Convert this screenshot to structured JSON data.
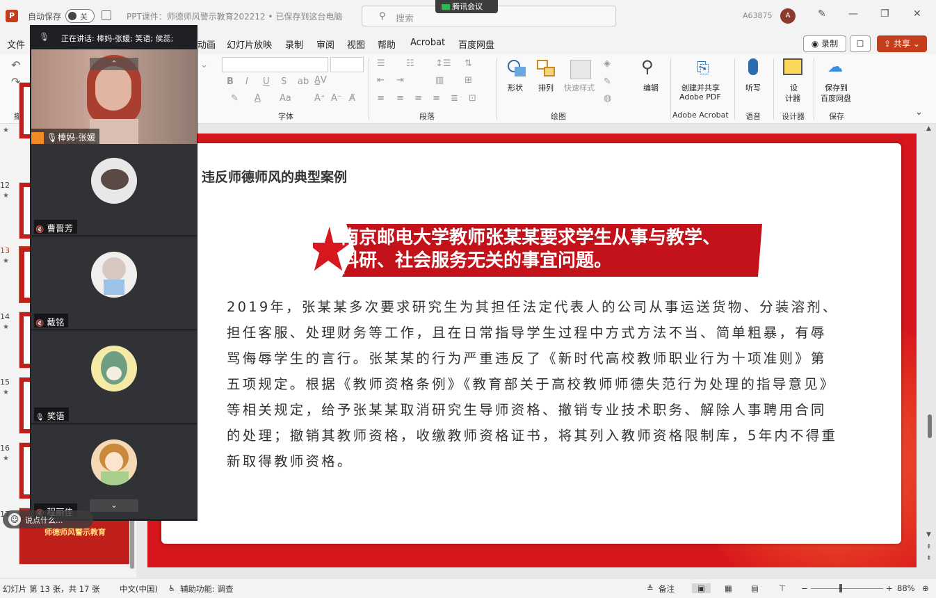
{
  "window": {
    "autosave_label": "自动保存",
    "autosave_state": "关",
    "title": "PPT课件：师德师风警示教育202212 • 已保存到这台电脑",
    "search_placeholder": "搜索",
    "meeting_app": "腾讯会议",
    "user_id": "A63875",
    "avatar_initial": "A"
  },
  "menu": {
    "items": [
      "文件",
      "动画",
      "幻灯片放映",
      "录制",
      "审阅",
      "视图",
      "帮助",
      "Acrobat",
      "百度网盘"
    ],
    "record_button": "录制",
    "share_button": "共享"
  },
  "ribbon": {
    "undo_group": "撤消",
    "font_group": "字体",
    "paragraph_group": "段落",
    "drawing_group": "绘图",
    "shapes": "形状",
    "arrange": "排列",
    "quick_styles": "快速样式",
    "editing": "编辑",
    "create_share_pdf": "创建并共享",
    "adobe_pdf": "Adobe PDF",
    "adobe_group": "Adobe Acrobat",
    "dictate": "听写",
    "voice_group": "语音",
    "designer_1": "设",
    "designer_2": "计器",
    "designer_group": "设计器",
    "save_baidu_1": "保存到",
    "save_baidu_2": "百度网盘",
    "save_group": "保存"
  },
  "thumbnails": [
    {
      "num": "",
      "star": "★"
    },
    {
      "num": "12",
      "star": "★"
    },
    {
      "num": "13",
      "star": "★",
      "active": true
    },
    {
      "num": "14",
      "star": "★"
    },
    {
      "num": "15",
      "star": "★"
    },
    {
      "num": "16",
      "star": "★"
    },
    {
      "num": "17",
      "star": "",
      "caption": "师德师风警示教育"
    }
  ],
  "slide": {
    "heading": "违反师德师风的典型案例",
    "banner": "南京邮电大学教师张某某要求学生从事与教学、科研、社会服务无关的事宜问题。",
    "body": "2019年，张某某多次要求研究生为其担任法定代表人的公司从事运送货物、分装溶剂、担任客服、处理财务等工作，且在日常指导学生过程中方式方法不当、简单粗暴，有辱骂侮辱学生的言行。张某某的行为严重违反了《新时代高校教师职业行为十项准则》第五项规定。根据《教师资格条例》《教育部关于高校教师师德失范行为处理的指导意见》等相关规定，给予张某某取消研究生导师资格、撤销专业技术职务、解除人事聘用合同的处理；撤销其教师资格，收缴教师资格证书，将其列入教师资格限制库，5年内不得重新取得教师资格。"
  },
  "status": {
    "slide_info": "幻灯片 第 13 张，共 17 张",
    "language": "中文(中国)",
    "accessibility": "辅助功能: 调查",
    "notes": "备注",
    "zoom": "88%"
  },
  "meeting": {
    "speaking": "正在讲话: 棒妈-张媛; 笑语; 侯蕊;",
    "participants": [
      "棒妈-张媛",
      "曹晋芳",
      "戴铭",
      "笑语",
      "程丽佳"
    ],
    "comment_hint": "说点什么..."
  }
}
